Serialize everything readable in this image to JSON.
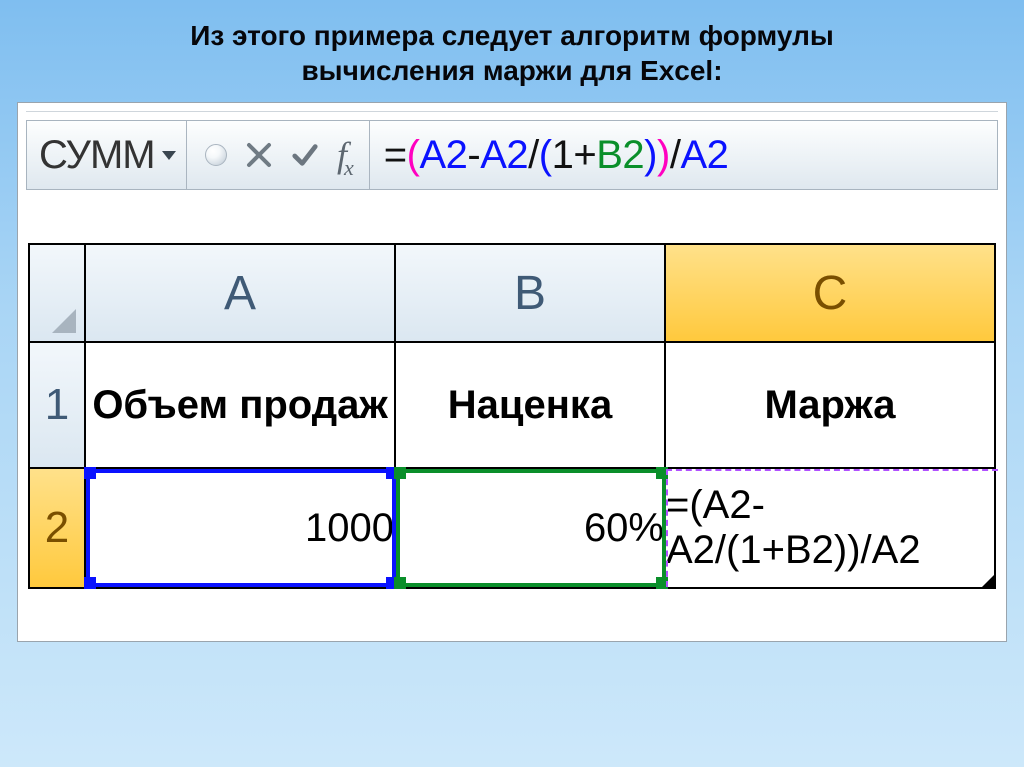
{
  "title_line1": "Из этого примера следует алгоритм формулы",
  "title_line2": "вычисления маржи для Excel:",
  "formula_bar": {
    "name_box": "СУММ",
    "formula_eq": "=",
    "formula_ref_a": "A2",
    "formula_minus": "-",
    "formula_div1": "/",
    "formula_one_plus": "1+",
    "formula_ref_b": "B2",
    "formula_div2": "/",
    "formula_outer_open": "(",
    "formula_outer_close": ")",
    "formula_inner_open": "(",
    "formula_inner_close": ")",
    "formula_tail_a": "A2"
  },
  "columns": {
    "A": "A",
    "B": "B",
    "C": "C"
  },
  "row_numbers": {
    "r1": "1",
    "r2": "2"
  },
  "headers": {
    "A": "Объем продаж",
    "B": "Наценка",
    "C": "Маржа"
  },
  "values": {
    "A2": "1000",
    "B2": "60%",
    "C2": "=(A2-A2/(1+B2))/A2"
  }
}
